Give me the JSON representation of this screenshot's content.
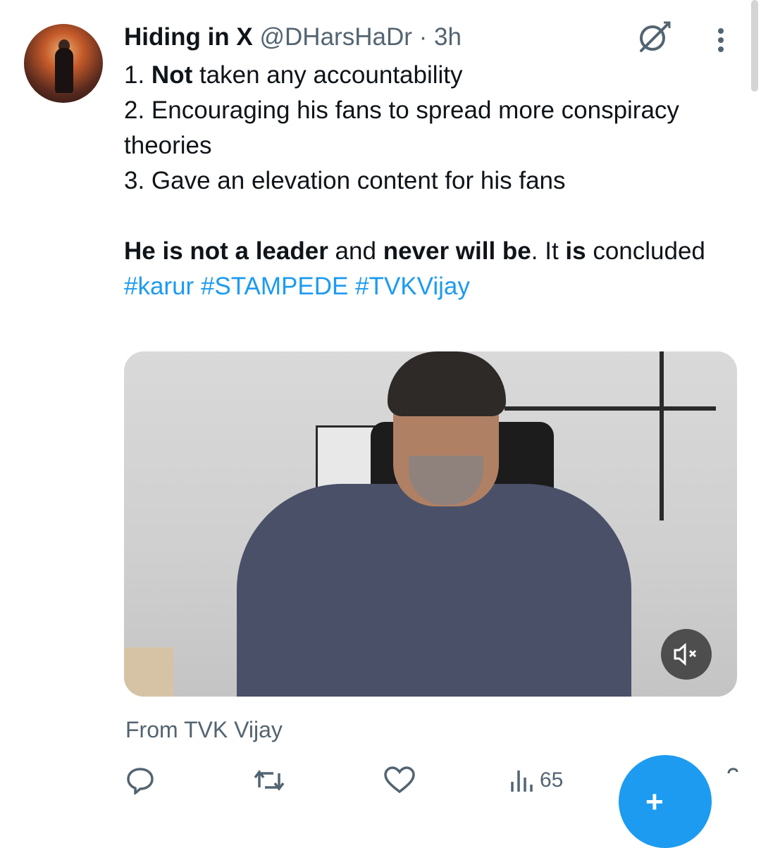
{
  "tweet": {
    "author_name": "Hiding in X",
    "handle": "@DHarsHaDr",
    "separator": "·",
    "time": "3h",
    "line1_prefix": "1. ",
    "line1_bold": "Not",
    "line1_rest": " taken any accountability",
    "line2": "2. Encouraging his fans to spread more conspiracy theories",
    "line3": "3. Gave an elevation content for his fans",
    "line4_bold1": "He is not a leader",
    "line4_mid1": " and ",
    "line4_bold2": "never will be",
    "line4_mid2": ". It ",
    "line4_bold3": "is",
    "line4_rest": " concluded",
    "hashtags": [
      "#karur",
      "#STAMPEDE",
      "#TVKVijay"
    ]
  },
  "media": {
    "source_label": "From TVK Vijay",
    "mute_icon": "speaker-muted-icon"
  },
  "actions": {
    "reply_icon": "reply-icon",
    "repost_icon": "repost-icon",
    "like_icon": "heart-icon",
    "views_icon": "views-icon",
    "views_count": "65"
  },
  "fab": {
    "icon": "compose-icon",
    "glyph": "+"
  },
  "colors": {
    "accent": "#1d9bf0",
    "secondary_text": "#536471",
    "primary_text": "#0f1419"
  }
}
